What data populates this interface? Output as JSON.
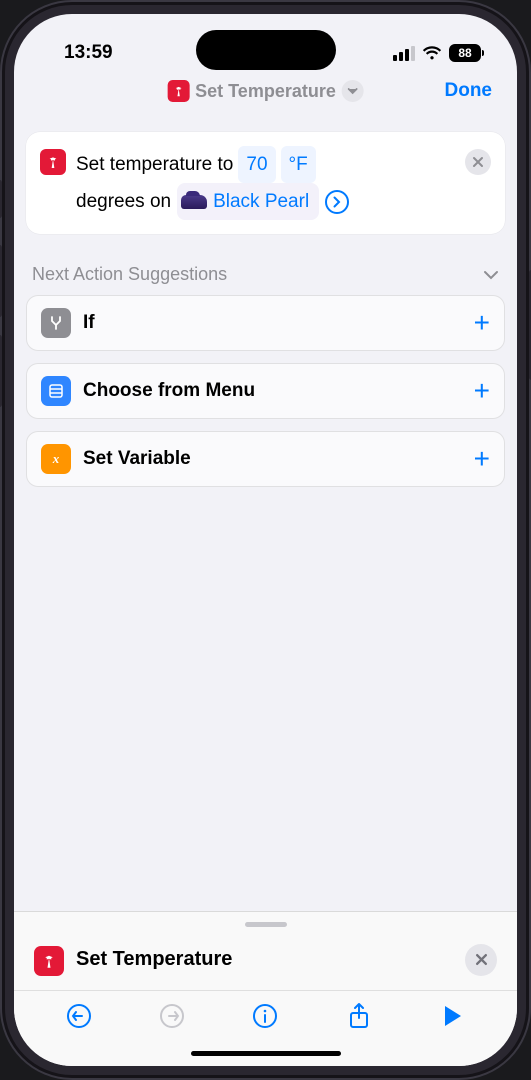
{
  "status": {
    "time": "13:59",
    "battery": "88"
  },
  "nav": {
    "title": "Set Temperature",
    "done": "Done"
  },
  "action": {
    "prefix": "Set temperature to",
    "temp_value": "70",
    "temp_unit": "°F",
    "mid": "degrees on",
    "vehicle": "Black Pearl"
  },
  "suggestions": {
    "header": "Next Action Suggestions",
    "items": [
      {
        "label": "If"
      },
      {
        "label": "Choose from Menu"
      },
      {
        "label": "Set Variable"
      }
    ]
  },
  "sheet": {
    "title": "Set Temperature"
  }
}
